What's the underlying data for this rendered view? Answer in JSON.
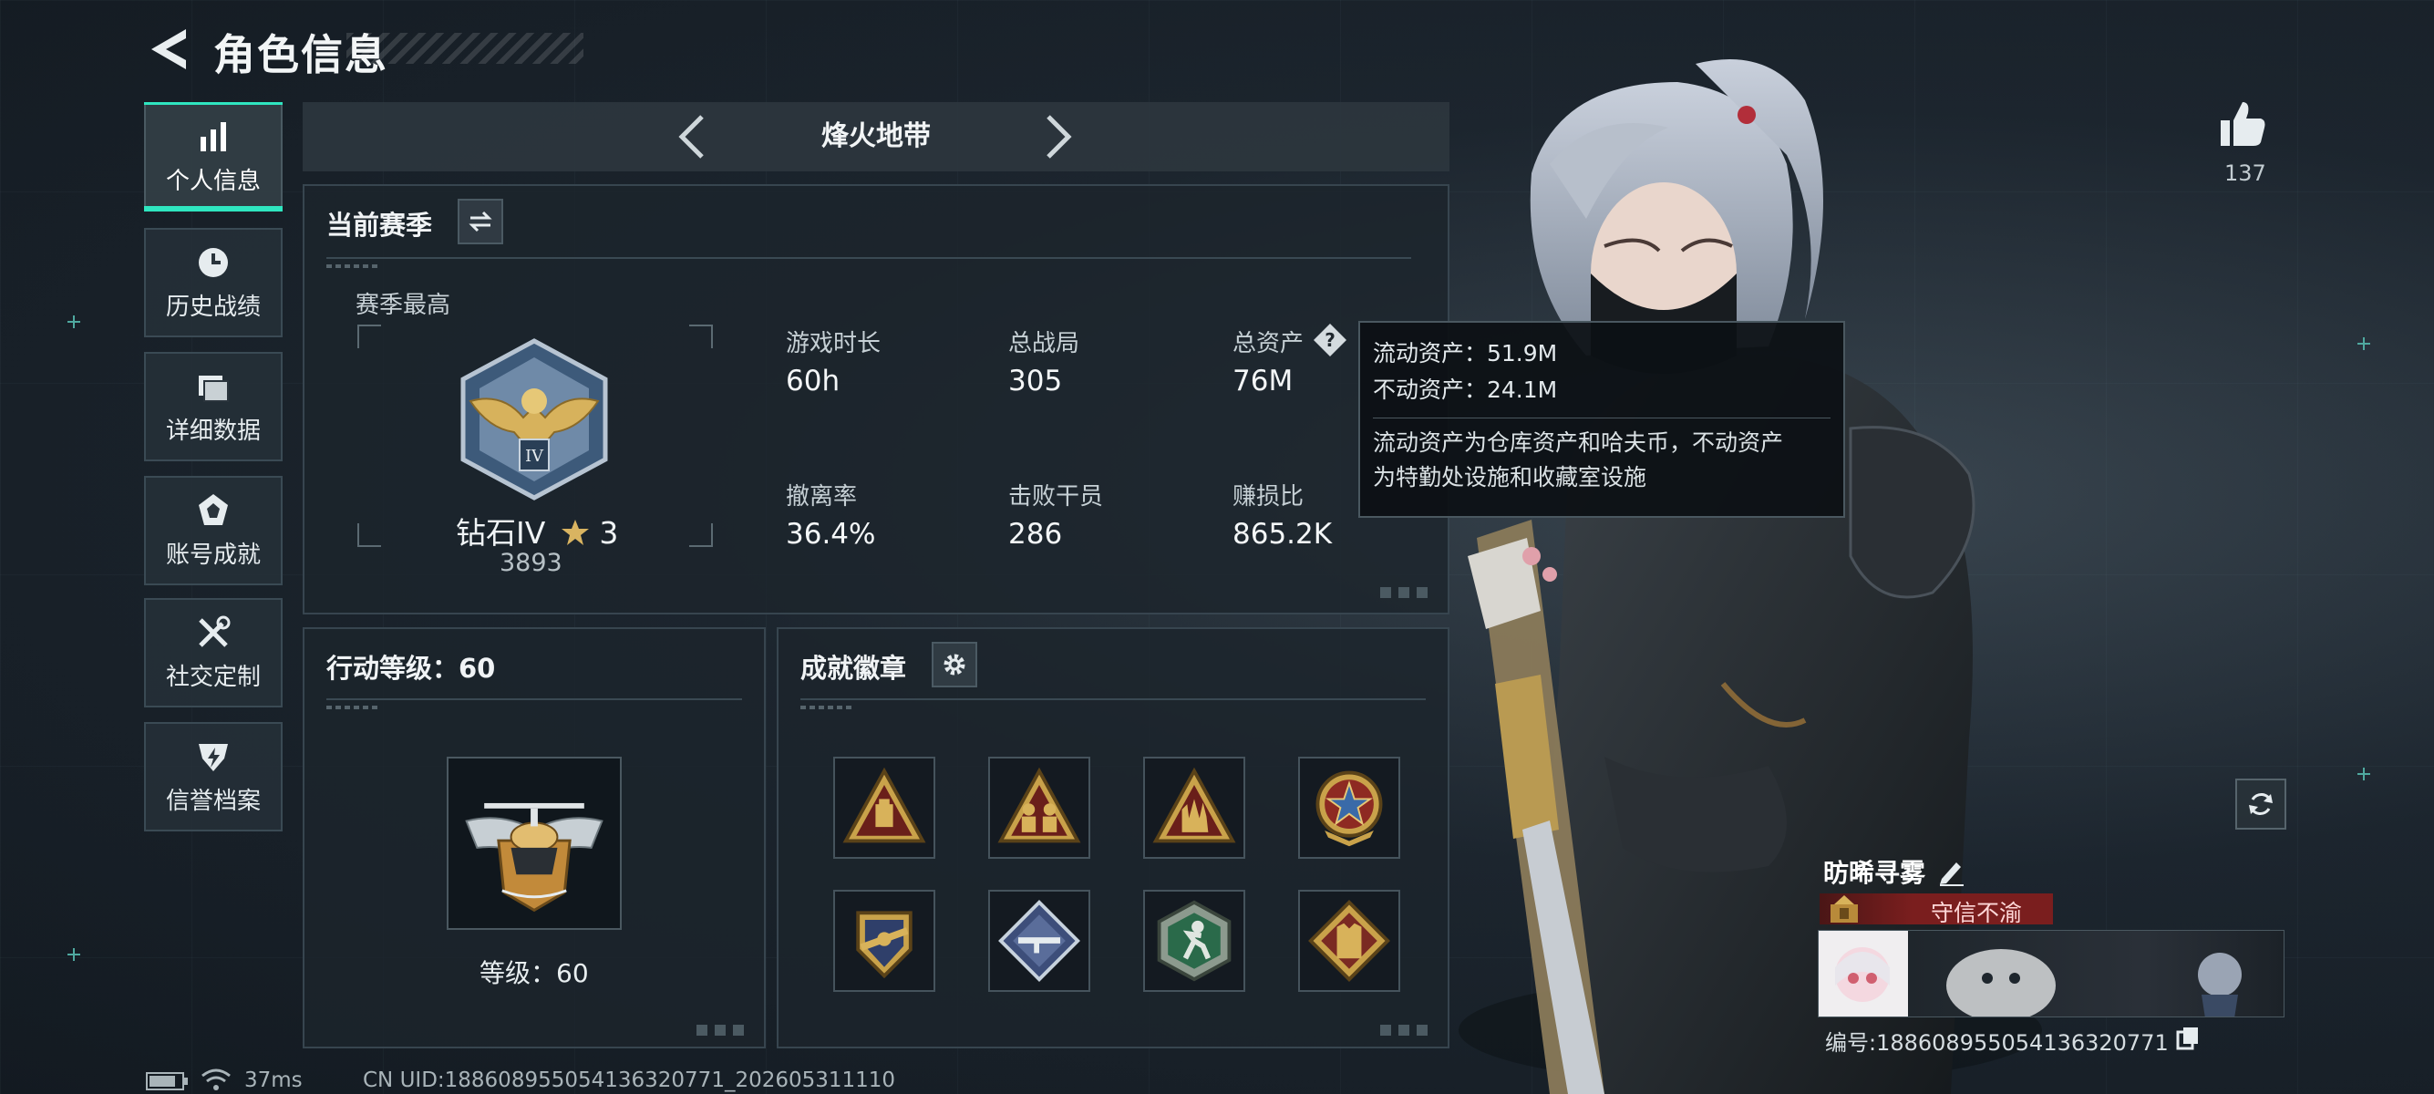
{
  "header": {
    "title": "角色信息"
  },
  "nav": {
    "items": [
      {
        "label": "个人信息",
        "icon": "bar-chart-icon",
        "active": true
      },
      {
        "label": "历史战绩",
        "icon": "clock-icon",
        "active": false
      },
      {
        "label": "详细数据",
        "icon": "folder-icon",
        "active": false
      },
      {
        "label": "账号成就",
        "icon": "achievement-icon",
        "active": false
      },
      {
        "label": "社交定制",
        "icon": "tools-icon",
        "active": false
      },
      {
        "label": "信誉档案",
        "icon": "shield-bolt-icon",
        "active": false
      }
    ]
  },
  "mode": {
    "title": "烽火地带"
  },
  "season": {
    "title": "当前赛季",
    "best_label": "赛季最高",
    "rank_name": "钻石IV",
    "rank_stars": "3",
    "rank_points": "3893",
    "stats": [
      {
        "label": "游戏时长",
        "value": "60h"
      },
      {
        "label": "总战局",
        "value": "305"
      },
      {
        "label": "总资产",
        "value": "76M"
      },
      {
        "label": "撤离率",
        "value": "36.4%"
      },
      {
        "label": "击败干员",
        "value": "286"
      },
      {
        "label": "赚损比",
        "value": "865.2K"
      }
    ]
  },
  "tooltip": {
    "line1": "流动资产：51.9M",
    "line2": "不动资产：24.1M",
    "desc1": "流动资产为仓库资产和哈夫币，不动资产",
    "desc2": "为特勤处设施和收藏室设施"
  },
  "action_level": {
    "title": "行动等级：60",
    "level_text": "等级：60"
  },
  "badges": {
    "title": "成就徽章",
    "items": [
      "badge-backpack-icon",
      "badge-squad-icon",
      "badge-hand-icon",
      "badge-star-icon",
      "badge-rifle-icon",
      "badge-gun-icon",
      "badge-runner-icon",
      "badge-vest-icon"
    ]
  },
  "likes": {
    "count": "137"
  },
  "player": {
    "name": "昉晞寻雾",
    "reputation": "守信不渝",
    "id_text": "编号:18860895505413632077​1"
  },
  "status_bar": {
    "ping": "37ms",
    "uid": "CN UID:18860895505413632077​1_202605311110"
  },
  "colors": {
    "accent": "#2fe6c0",
    "reputation": "#7a1e1e",
    "badge_gold": "#c9a24a"
  }
}
